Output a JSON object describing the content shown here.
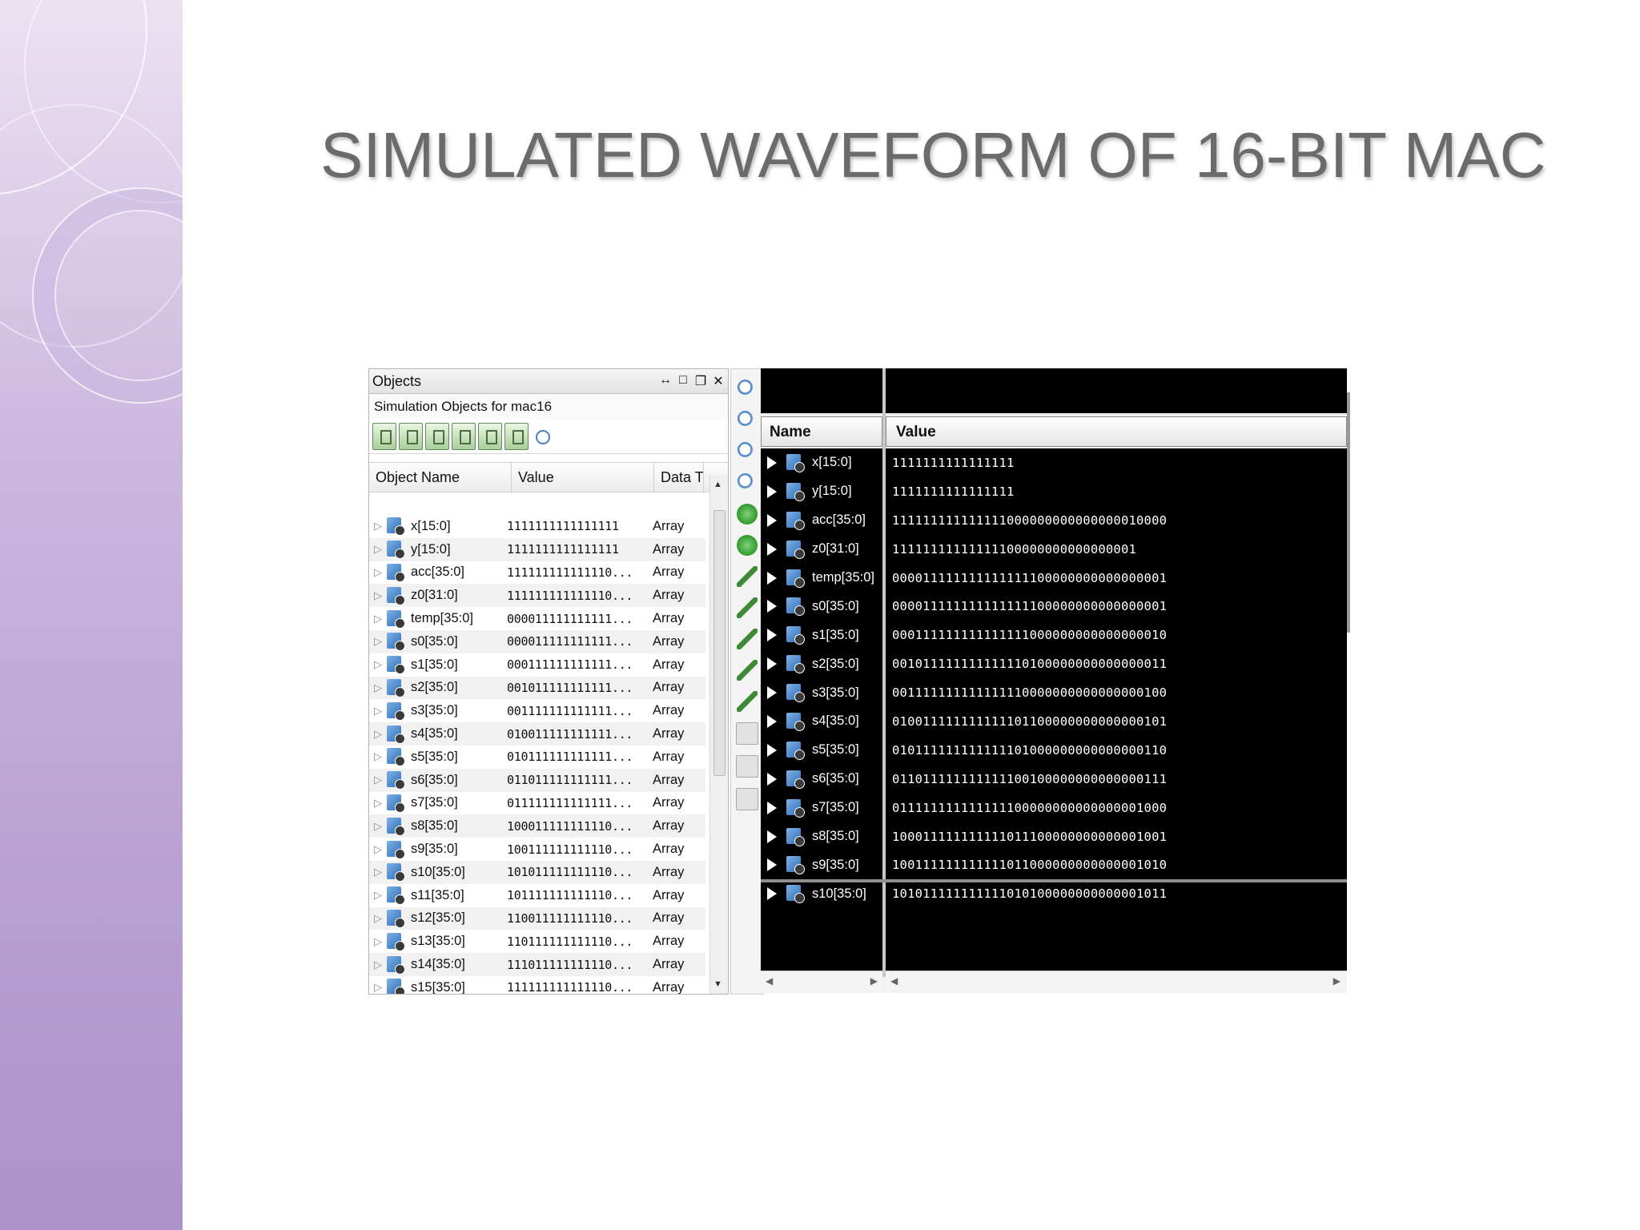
{
  "slide": {
    "title": "SIMULATED WAVEFORM OF 16-BIT MAC"
  },
  "objects_panel": {
    "title": "Objects",
    "subtitle": "Simulation Objects for mac16",
    "columns": [
      "Object Name",
      "Value",
      "Data Ty"
    ],
    "rows": [
      {
        "name": "x[15:0]",
        "value": "1111111111111111",
        "type": "Array"
      },
      {
        "name": "y[15:0]",
        "value": "1111111111111111",
        "type": "Array"
      },
      {
        "name": "acc[35:0]",
        "value": "111111111111110...",
        "type": "Array"
      },
      {
        "name": "z0[31:0]",
        "value": "111111111111110...",
        "type": "Array"
      },
      {
        "name": "temp[35:0]",
        "value": "000011111111111...",
        "type": "Array"
      },
      {
        "name": "s0[35:0]",
        "value": "000011111111111...",
        "type": "Array"
      },
      {
        "name": "s1[35:0]",
        "value": "000111111111111...",
        "type": "Array"
      },
      {
        "name": "s2[35:0]",
        "value": "001011111111111...",
        "type": "Array"
      },
      {
        "name": "s3[35:0]",
        "value": "001111111111111...",
        "type": "Array"
      },
      {
        "name": "s4[35:0]",
        "value": "010011111111111...",
        "type": "Array"
      },
      {
        "name": "s5[35:0]",
        "value": "010111111111111...",
        "type": "Array"
      },
      {
        "name": "s6[35:0]",
        "value": "011011111111111...",
        "type": "Array"
      },
      {
        "name": "s7[35:0]",
        "value": "011111111111111...",
        "type": "Array"
      },
      {
        "name": "s8[35:0]",
        "value": "100011111111110...",
        "type": "Array"
      },
      {
        "name": "s9[35:0]",
        "value": "100111111111110...",
        "type": "Array"
      },
      {
        "name": "s10[35:0]",
        "value": "101011111111110...",
        "type": "Array"
      },
      {
        "name": "s11[35:0]",
        "value": "101111111111110...",
        "type": "Array"
      },
      {
        "name": "s12[35:0]",
        "value": "110011111111110...",
        "type": "Array"
      },
      {
        "name": "s13[35:0]",
        "value": "110111111111110...",
        "type": "Array"
      },
      {
        "name": "s14[35:0]",
        "value": "111011111111110...",
        "type": "Array"
      },
      {
        "name": "s15[35:0]",
        "value": "111111111111110...",
        "type": "Array"
      }
    ]
  },
  "waveform": {
    "name_header": "Name",
    "value_header": "Value",
    "signals": [
      {
        "name": "x[15:0]",
        "value": "1111111111111111"
      },
      {
        "name": "y[15:0]",
        "value": "1111111111111111"
      },
      {
        "name": "acc[35:0]",
        "value": "111111111111111000000000000000010000"
      },
      {
        "name": "z0[31:0]",
        "value": "11111111111111100000000000000001"
      },
      {
        "name": "temp[35:0]",
        "value": "000011111111111111100000000000000001"
      },
      {
        "name": "s0[35:0]",
        "value": "000011111111111111100000000000000001"
      },
      {
        "name": "s1[35:0]",
        "value": "000111111111111111000000000000000010"
      },
      {
        "name": "s2[35:0]",
        "value": "001011111111111110100000000000000011"
      },
      {
        "name": "s3[35:0]",
        "value": "001111111111111110000000000000000100"
      },
      {
        "name": "s4[35:0]",
        "value": "010011111111111101100000000000000101"
      },
      {
        "name": "s5[35:0]",
        "value": "010111111111111101000000000000000110"
      },
      {
        "name": "s6[35:0]",
        "value": "011011111111111100100000000000000111"
      },
      {
        "name": "s7[35:0]",
        "value": "011111111111111100000000000000001000"
      },
      {
        "name": "s8[35:0]",
        "value": "100011111111111011100000000000001001"
      },
      {
        "name": "s9[35:0]",
        "value": "100111111111111011000000000000001010"
      },
      {
        "name": "s10[35:0]",
        "value": "101011111111111010100000000000001011"
      }
    ]
  }
}
